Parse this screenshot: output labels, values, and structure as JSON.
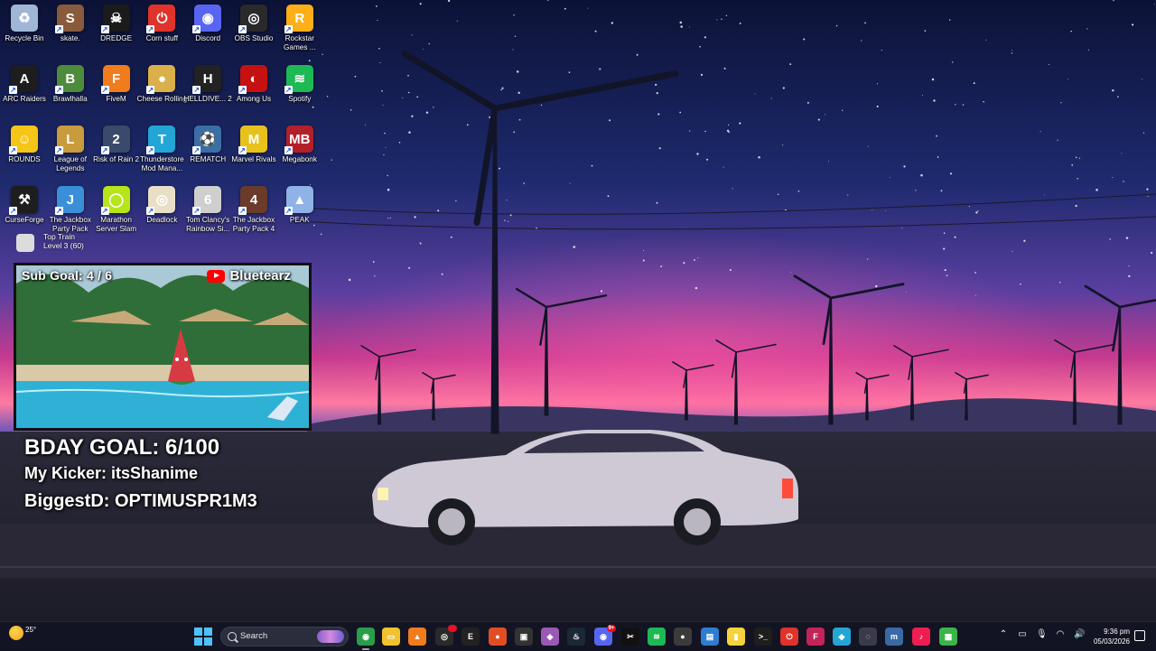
{
  "desktop": {
    "icons": [
      {
        "label": "Recycle Bin",
        "icon": "recycle-bin-icon",
        "color": "#9fb6d6",
        "glyph": "♻",
        "shortcut": false
      },
      {
        "label": "skate.",
        "icon": "skate-icon",
        "color": "#8a5a3c",
        "glyph": "S",
        "shortcut": true
      },
      {
        "label": "DREDGE",
        "icon": "dredge-icon",
        "color": "#1b1b1b",
        "glyph": "☠",
        "shortcut": true
      },
      {
        "label": "Corn stuff",
        "icon": "power-icon",
        "color": "#e0332b",
        "glyph": "⏻",
        "shortcut": true
      },
      {
        "label": "Discord",
        "icon": "discord-icon",
        "color": "#5865f2",
        "glyph": "◉",
        "shortcut": true
      },
      {
        "label": "OBS Studio",
        "icon": "obs-icon",
        "color": "#2a2a2a",
        "glyph": "◎",
        "shortcut": true
      },
      {
        "label": "Rockstar Games ...",
        "icon": "rockstar-icon",
        "color": "#fcaf17",
        "glyph": "R",
        "shortcut": true
      },
      {
        "label": "ARC Raiders",
        "icon": "arc-raiders-icon",
        "color": "#1d1d1d",
        "glyph": "A",
        "shortcut": true
      },
      {
        "label": "Brawlhalla",
        "icon": "brawlhalla-icon",
        "color": "#4d8c3a",
        "glyph": "B",
        "shortcut": true
      },
      {
        "label": "FiveM",
        "icon": "fivem-icon",
        "color": "#f07c1e",
        "glyph": "F",
        "shortcut": true
      },
      {
        "label": "Cheese Rolling",
        "icon": "cheese-icon",
        "color": "#d9b04a",
        "glyph": "●",
        "shortcut": true
      },
      {
        "label": "HELLDIVE... 2",
        "icon": "helldivers-icon",
        "color": "#222222",
        "glyph": "H",
        "shortcut": true
      },
      {
        "label": "Among Us",
        "icon": "among-us-icon",
        "color": "#c51111",
        "glyph": "◐",
        "shortcut": true
      },
      {
        "label": "Spotify",
        "icon": "spotify-icon",
        "color": "#1db954",
        "glyph": "≋",
        "shortcut": true
      },
      {
        "label": "ROUNDS",
        "icon": "rounds-icon",
        "color": "#f5c518",
        "glyph": "☺",
        "shortcut": true
      },
      {
        "label": "League of Legends",
        "icon": "league-icon",
        "color": "#c89b3c",
        "glyph": "L",
        "shortcut": true
      },
      {
        "label": "Risk of Rain 2",
        "icon": "risk-of-rain-icon",
        "color": "#3a4a6a",
        "glyph": "2",
        "shortcut": true
      },
      {
        "label": "Thunderstore Mod Mana...",
        "icon": "thunderstore-icon",
        "color": "#23a6d5",
        "glyph": "T",
        "shortcut": true
      },
      {
        "label": "REMATCH",
        "icon": "rematch-icon",
        "color": "#3a6ea5",
        "glyph": "⚽",
        "shortcut": true
      },
      {
        "label": "Marvel Rivals",
        "icon": "marvel-rivals-icon",
        "color": "#e8c21a",
        "glyph": "M",
        "shortcut": true
      },
      {
        "label": "Megabonk",
        "icon": "megabonk-icon",
        "color": "#b3202a",
        "glyph": "MB",
        "shortcut": true
      },
      {
        "label": "CurseForge",
        "icon": "curseforge-icon",
        "color": "#1e1e1e",
        "glyph": "⚒",
        "shortcut": true
      },
      {
        "label": "The Jackbox Party Pack",
        "icon": "jackbox-icon",
        "color": "#3b8fd9",
        "glyph": "J",
        "shortcut": true
      },
      {
        "label": "Marathon Server Slam",
        "icon": "marathon-icon",
        "color": "#b6e51a",
        "glyph": "◯",
        "shortcut": true
      },
      {
        "label": "Deadlock",
        "icon": "deadlock-icon",
        "color": "#e9dfc7",
        "glyph": "◎",
        "shortcut": true
      },
      {
        "label": "Tom Clancy's Rainbow Si...",
        "icon": "rainbow-six-icon",
        "color": "#cfcfcf",
        "glyph": "6",
        "shortcut": true
      },
      {
        "label": "The Jackbox Party Pack 4",
        "icon": "jackbox-4-icon",
        "color": "#6a3a2a",
        "glyph": "4",
        "shortcut": true
      },
      {
        "label": "PEAK",
        "icon": "peak-icon",
        "color": "#8fb3e6",
        "glyph": "▲",
        "shortcut": true
      }
    ]
  },
  "overlay": {
    "train": {
      "title": "Top Train",
      "level": "Level 3 (60)"
    },
    "sub_goal": "Sub Goal: 4 / 6",
    "channel_name": "Bluetearz",
    "bday_goal": "BDAY GOAL: 6/100",
    "kicker": "My Kicker: itsShanime",
    "biggest": "BiggestD: OPTIMUSPR1M3"
  },
  "taskbar": {
    "weather_temp": "25°",
    "search_placeholder": "Search",
    "apps": [
      {
        "name": "chrome-icon",
        "color": "#2a9d4a",
        "glyph": "◉",
        "active": true
      },
      {
        "name": "file-explorer-icon",
        "color": "#f2c12e",
        "glyph": "▭",
        "active": false
      },
      {
        "name": "vlc-icon",
        "color": "#f07c1e",
        "glyph": "▲",
        "active": false
      },
      {
        "name": "obs-taskbar-icon",
        "color": "#2a2a2a",
        "glyph": "◎",
        "active": false,
        "badge": " "
      },
      {
        "name": "epic-games-icon",
        "color": "#222222",
        "glyph": "E",
        "active": false
      },
      {
        "name": "brave-icon",
        "color": "#e24d24",
        "glyph": "●",
        "active": false
      },
      {
        "name": "capture-icon",
        "color": "#333333",
        "glyph": "▣",
        "active": false
      },
      {
        "name": "purple-app-icon",
        "color": "#9b59b6",
        "glyph": "◈",
        "active": false
      },
      {
        "name": "steam-icon",
        "color": "#1b2838",
        "glyph": "♨",
        "active": false
      },
      {
        "name": "discord-taskbar-icon",
        "color": "#5865f2",
        "glyph": "◉",
        "active": false,
        "badge": "9+"
      },
      {
        "name": "capcut-icon",
        "color": "#111111",
        "glyph": "✂",
        "active": false
      },
      {
        "name": "spotify-taskbar-icon",
        "color": "#1db954",
        "glyph": "≋",
        "active": false
      },
      {
        "name": "bear-app-icon",
        "color": "#3b3b3b",
        "glyph": "●",
        "active": false
      },
      {
        "name": "photos-icon",
        "color": "#2d7dd2",
        "glyph": "▤",
        "active": false
      },
      {
        "name": "sticky-notes-icon",
        "color": "#f6d33c",
        "glyph": "▮",
        "active": false
      },
      {
        "name": "terminal-icon",
        "color": "#1e1e1e",
        "glyph": ">_",
        "active": false
      },
      {
        "name": "power-taskbar-icon",
        "color": "#e0332b",
        "glyph": "⏻",
        "active": false
      },
      {
        "name": "fivem-taskbar-icon",
        "color": "#c2245a",
        "glyph": "F",
        "active": false
      },
      {
        "name": "thunderstore-taskbar-icon",
        "color": "#23a6d5",
        "glyph": "◆",
        "active": false
      },
      {
        "name": "ring-app-icon",
        "color": "#3a3a4a",
        "glyph": "◌",
        "active": false
      },
      {
        "name": "mobile-app-icon",
        "color": "#3a6aa5",
        "glyph": "m",
        "active": false
      },
      {
        "name": "tiktok-icon",
        "color": "#ee1d52",
        "glyph": "♪",
        "active": false
      },
      {
        "name": "rematch-taskbar-icon",
        "color": "#3ab54a",
        "glyph": "▦",
        "active": false
      }
    ],
    "time": "9:36 pm",
    "date": "05/03/2026"
  },
  "colors": {
    "accent": "#4cc2ff",
    "sky_top": "#0d1740",
    "sky_pink": "#e03a8c",
    "sky_orange": "#ff8a5c"
  }
}
